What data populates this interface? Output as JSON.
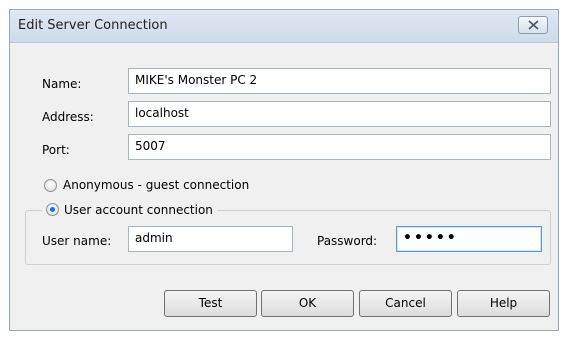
{
  "window": {
    "title": "Edit Server Connection"
  },
  "form": {
    "name_label": "Name:",
    "name_value": "MIKE's Monster PC 2",
    "address_label": "Address:",
    "address_value": "localhost",
    "port_label": "Port:",
    "port_value": "5007"
  },
  "connection": {
    "anonymous_label": "Anonymous - guest connection",
    "anonymous_selected": false,
    "user_account_label": "User account connection",
    "user_account_selected": true,
    "username_label": "User name:",
    "username_value": "admin",
    "password_label": "Password:",
    "password_value": "•••••"
  },
  "buttons": {
    "test": "Test",
    "ok": "OK",
    "cancel": "Cancel",
    "help": "Help"
  },
  "icons": {
    "close": "close-icon"
  },
  "colors": {
    "accent": "#1b6fd6",
    "titlebar": "#d7e1ee"
  }
}
